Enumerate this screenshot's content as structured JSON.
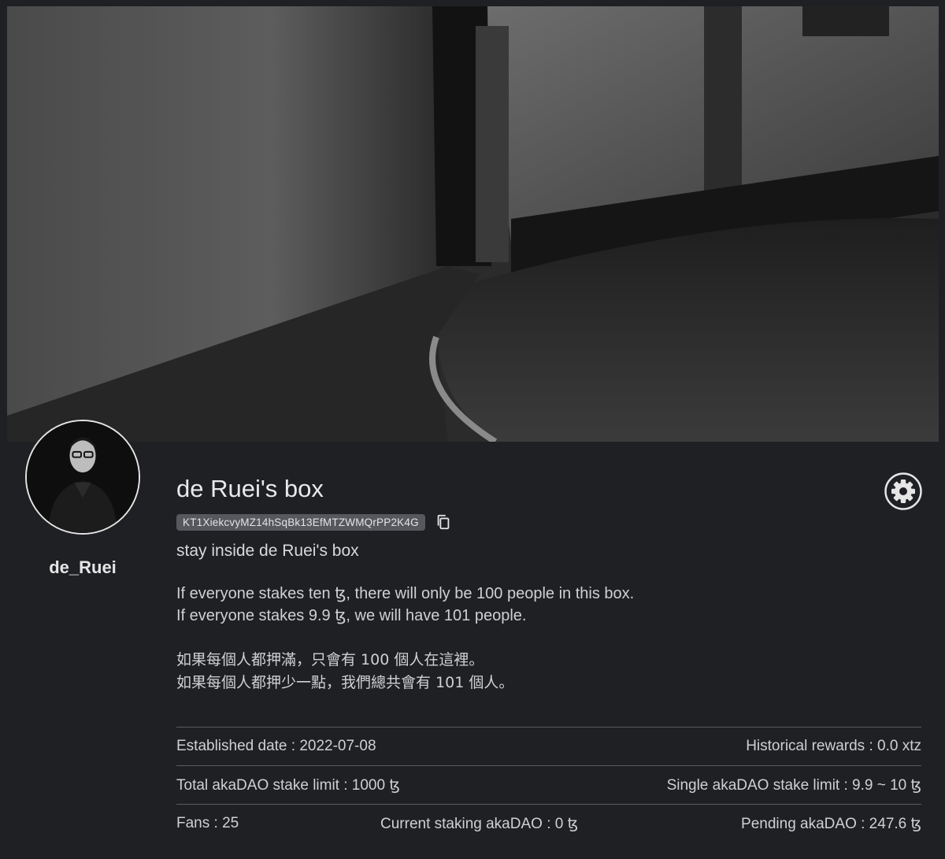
{
  "box": {
    "title": "de Ruei's box",
    "address": "KT1XiekcvyMZ14hSqBk13EfMTZWMQrPP2K4G",
    "subtitle": "stay inside de Ruei's box",
    "description_en": [
      "If everyone stakes ten ꜩ, there will only be 100 people in this box.",
      "If everyone stakes 9.9 ꜩ, we will have 101 people."
    ],
    "description_zh": [
      "如果每個人都押滿，只會有 100 個人在這裡。",
      "如果每個人都押少一點，我們總共會有 101 個人。"
    ]
  },
  "owner": {
    "username": "de_Ruei"
  },
  "stats": {
    "established": "Established date : 2022-07-08",
    "historical_rewards": "Historical rewards : 0.0 xtz",
    "total_limit": "Total akaDAO stake limit : 1000 ꜩ",
    "single_limit": "Single akaDAO stake limit : 9.9 ~ 10 ꜩ",
    "fans": "Fans : 25",
    "current_staking": "Current staking akaDAO : 0 ꜩ",
    "pending": "Pending akaDAO : 247.6 ꜩ"
  },
  "icons": {
    "copy": "copy-icon",
    "settings": "gear-icon"
  }
}
